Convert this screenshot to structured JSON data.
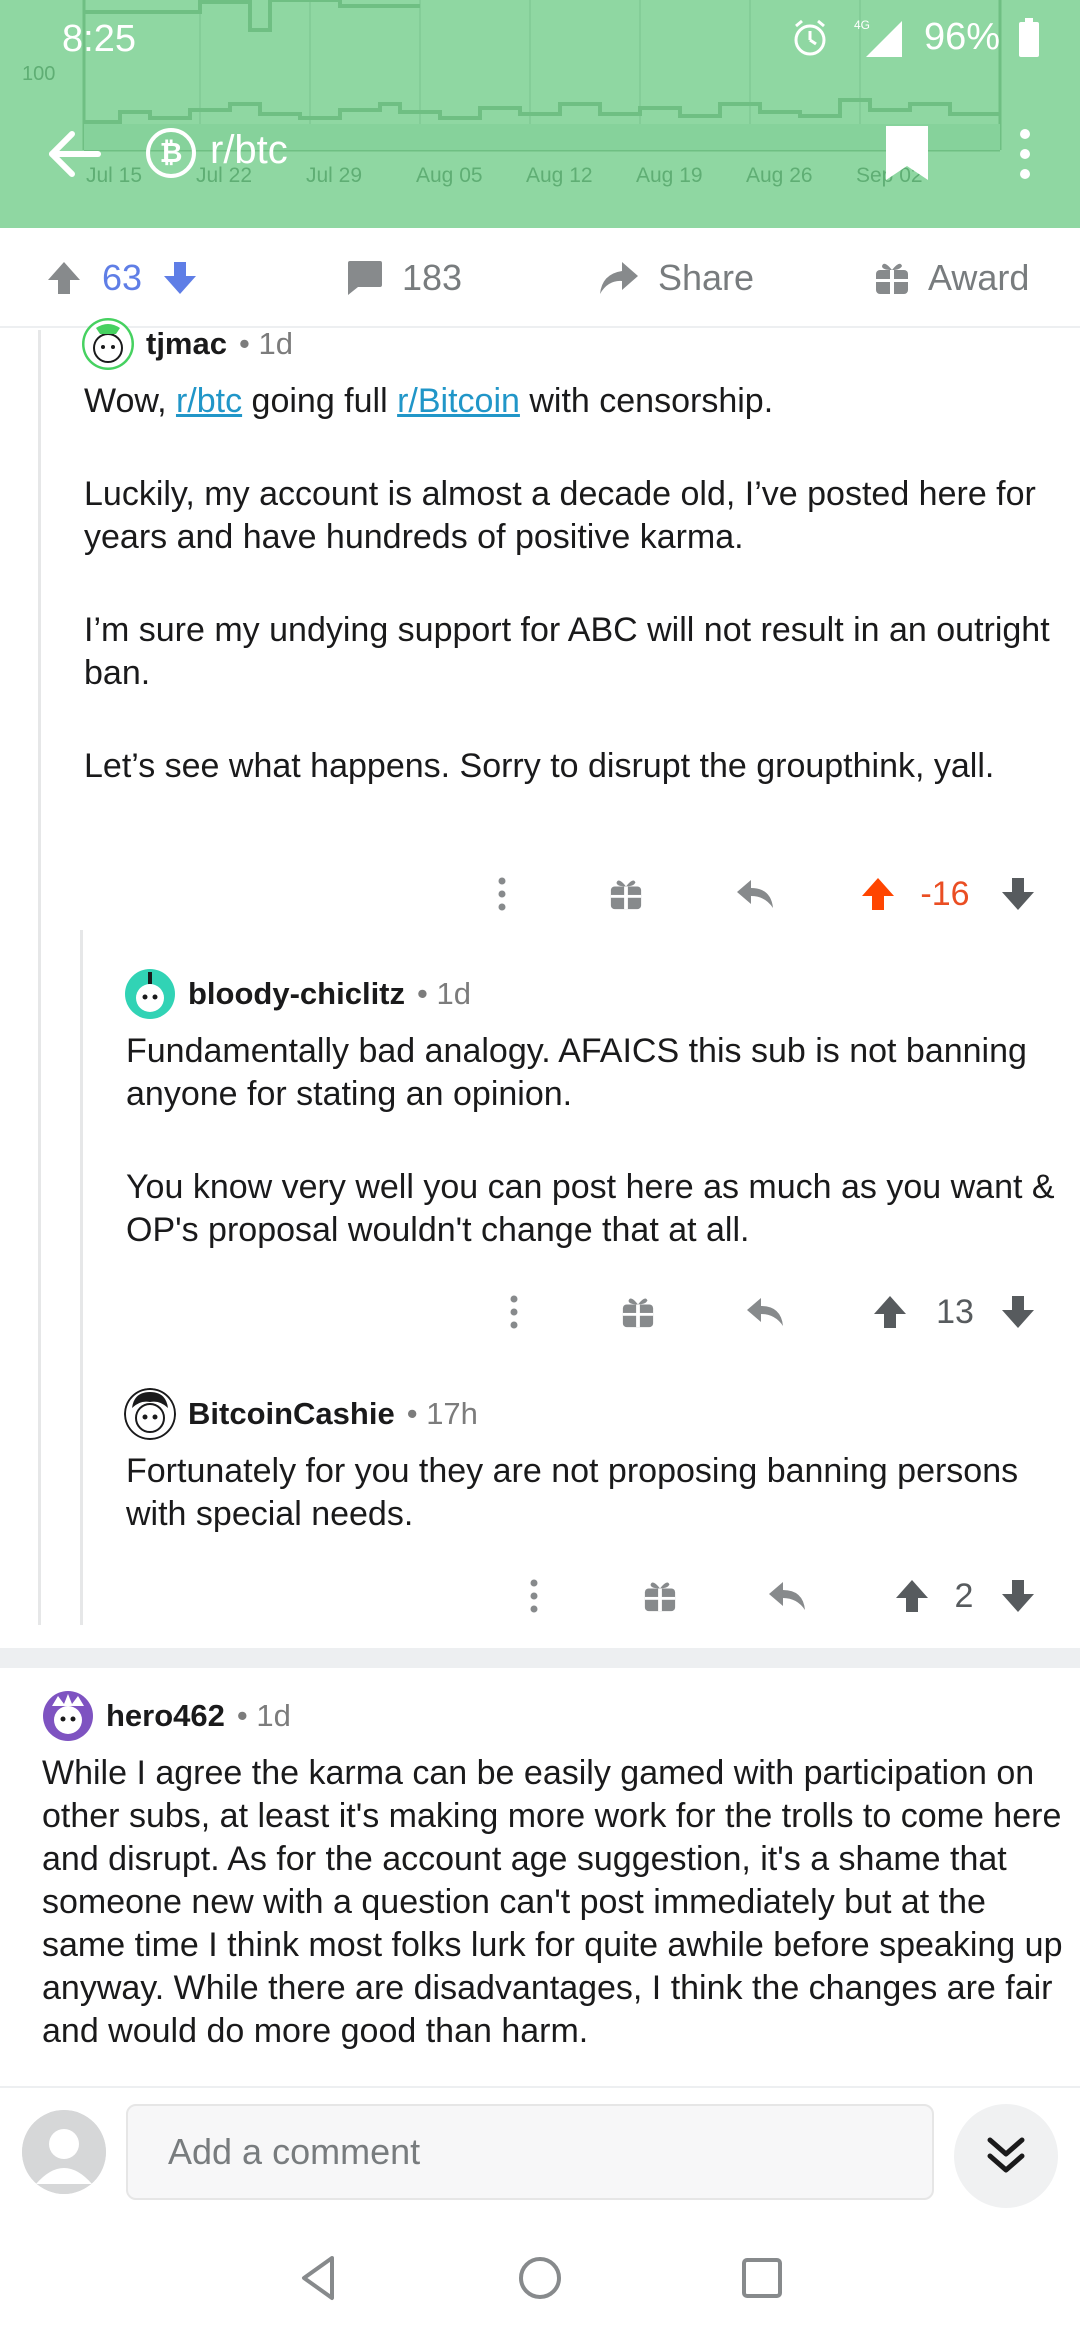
{
  "status_bar": {
    "time": "8:25",
    "network": "4G",
    "battery": "96%"
  },
  "header": {
    "subreddit": "r/btc",
    "chart": {
      "y_label": "100",
      "x_labels": [
        "Jul 15",
        "Jul 22",
        "Jul 29",
        "Aug 05",
        "Aug 12",
        "Aug 19",
        "Aug 26",
        "Sep 02"
      ]
    },
    "colors": {
      "background": "#8fd7a2",
      "line": "#6fbf83"
    }
  },
  "post_actions": {
    "score": "63",
    "comments": "183",
    "share_label": "Share",
    "award_label": "Award"
  },
  "comments": [
    {
      "author": "tjmac",
      "age": "1d",
      "body_prefix": "Wow, ",
      "link1": "r/btc",
      "body_mid": " going full ",
      "link2": "r/Bitcoin",
      "body_suffix": " with censorship.",
      "p2": "Luckily, my account is almost a decade old, I’ve posted here for years and have hundreds of positive karma.",
      "p3": "I’m sure my undying support for ABC will not result in an outright ban.",
      "p4": "Let’s see what happens. Sorry to disrupt the groupthink, yall.",
      "score": "-16",
      "upvoted": true
    },
    {
      "author": "bloody-chiclitz",
      "age": "1d",
      "p1": "Fundamentally bad analogy.  AFAICS this sub is not banning anyone for stating an opinion.",
      "p2": "You know very well you can post here as much as you want & OP's proposal wouldn't change that at all.",
      "score": "13"
    },
    {
      "author": "BitcoinCashie",
      "age": "17h",
      "p1": "Fortunately for you they are not proposing banning persons with special needs.",
      "score": "2"
    },
    {
      "author": "hero462",
      "age": "1d",
      "p1": "While I agree the karma can be easily gamed with participation on other subs, at least it's making more work for the trolls to come here and disrupt.  As for the account age suggestion, it's a shame that someone new with a question can't post immediately but at the same time I think most folks lurk for quite awhile before speaking up anyway. While there are disadvantages, I think the changes are fair and would do more good than harm."
    }
  ],
  "comment_bar": {
    "placeholder": "Add a comment"
  },
  "colors": {
    "upvote_active": "#ff4500",
    "downvote_blue": "#5f7ee6",
    "link": "#2196c8",
    "separator": "#edeff1"
  }
}
